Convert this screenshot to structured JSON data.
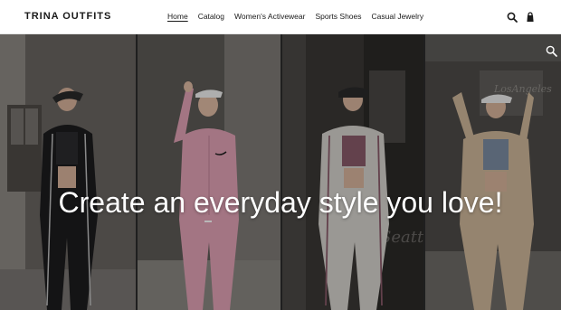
{
  "header": {
    "logo": "TRINA OUTFITS",
    "nav": [
      {
        "label": "Home",
        "active": true
      },
      {
        "label": "Catalog"
      },
      {
        "label": "Women's Activewear"
      },
      {
        "label": "Sports Shoes"
      },
      {
        "label": "Casual Jewelry"
      }
    ],
    "icons": [
      "search-icon",
      "cart-icon"
    ]
  },
  "hero": {
    "headline": "Create an everyday style you love!",
    "zoom_icon": "zoom-icon",
    "panels": [
      {
        "bg": "#5a5652",
        "outfit": "#1c1c1e",
        "accent": "#c0c0c0"
      },
      {
        "bg": "#6b6864",
        "outfit": "#e2a3b6",
        "accent": "#ffffff"
      },
      {
        "bg": "#3f3c39",
        "outfit": "#d6d3ce",
        "accent": "#8a5a6a"
      },
      {
        "bg": "#555350",
        "outfit": "#cfb79a",
        "accent": "#7c8da3"
      }
    ],
    "overlay_color": "#000000"
  }
}
